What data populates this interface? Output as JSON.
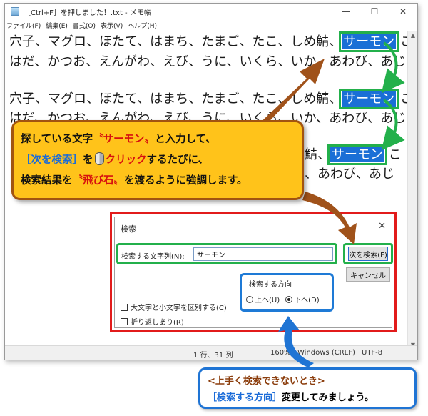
{
  "window": {
    "title": "［Ctrl+F］を押しました！.txt - メモ帳",
    "controls": {
      "minimize": "—",
      "maximize": "☐",
      "close": "✕"
    }
  },
  "menu": [
    "ファイル(F)",
    "編集(E)",
    "書式(O)",
    "表示(V)",
    "ヘルプ(H)"
  ],
  "editor": {
    "para1_line1_before": "穴子、マグロ、ほたて、はまち、たまご、たこ、しめ鯖、",
    "para1_line2": "はだ、かつお、えんがわ、えび、うに、いくら、いか、あわび、あじ",
    "para2_line1_before": "穴子、マグロ、ほたて、はまち、たまご、たこ、しめ鯖、",
    "para2_line2": "はだ、かつお、えんがわ、えび、うに、いくら、いか、あわび、あじ",
    "para3_line1_fragment": "鯖、",
    "para3_line2_fragment": "、あわび、あじ",
    "highlight": "サーモン",
    "trailing": "こ"
  },
  "statusbar": {
    "position": "1 行、31 列",
    "zoom": "160%",
    "eol": "Windows (CRLF)",
    "encoding": "UTF-8"
  },
  "find_dialog": {
    "title": "検索",
    "close": "✕",
    "search_label": "検索する文字列(N):",
    "search_value": "サーモン",
    "next_button": "次を検索(F)",
    "cancel_button": "キャンセル",
    "direction_title": "検索する方向",
    "direction_up": "上へ(U)",
    "direction_down": "下へ(D)",
    "direction_selected": "down",
    "match_case": "大文字と小文字を区別する(C)",
    "wrap_around": "折り返しあり(R)"
  },
  "callout_main": {
    "l1_a": "探している文字",
    "l1_b": "〝サーモン〟",
    "l1_c": "と入力して、",
    "l2_a": "［次を検索］",
    "l2_b": "を",
    "l2_c": "クリック",
    "l2_d": "するたびに、",
    "l3_a": "検索結果を",
    "l3_b": "〝飛び石〟",
    "l3_c": "を渡るように強調します。"
  },
  "callout_tip": {
    "l1": "<上手く検索できないとき>",
    "l2_a": "［検索する方向］",
    "l2_b": "変更してみましょう。"
  },
  "colors": {
    "highlight_bg": "#1a6fd6",
    "green_frame": "#23b04b",
    "red_frame": "#e21b1b",
    "blue_frame": "#1f74d4",
    "callout_orange": "#ffc31a",
    "arrow_brown": "#a0521a"
  }
}
